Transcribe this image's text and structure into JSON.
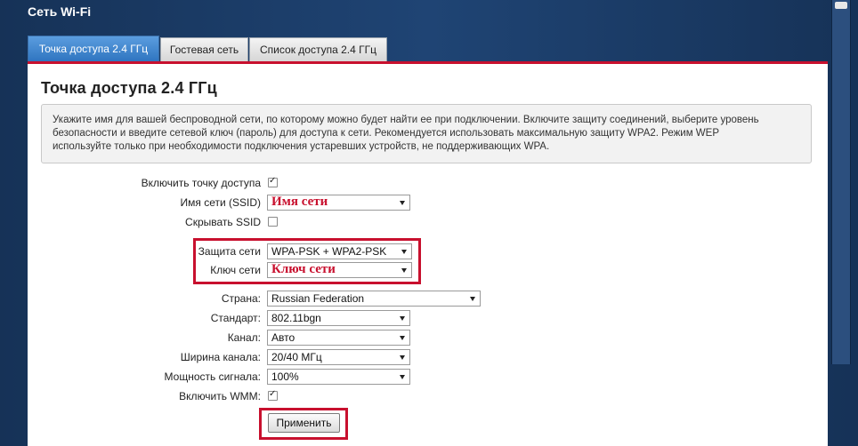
{
  "app": {
    "title": "Сеть Wi-Fi"
  },
  "tabs": [
    {
      "label": "Точка доступа 2.4 ГГц",
      "active": true
    },
    {
      "label": "Гостевая сеть",
      "active": false
    },
    {
      "label": "Список доступа 2.4 ГГц",
      "active": false
    }
  ],
  "page": {
    "title": "Точка доступа 2.4 ГГц",
    "info_line1": "Укажите имя для вашей беспроводной сети, по которому можно будет найти ее при подключении. Включите защиту соединений, выберите уровень",
    "info_line2": "безопасности и введите сетевой ключ (пароль) для доступа к сети. Рекомендуется использовать максимальную защиту WPA2. Режим WEP",
    "info_line3": "используйте только при необходимости подключения устаревших устройств, не поддерживающих WPA."
  },
  "form": {
    "enable_ap": {
      "label": "Включить точку доступа",
      "checked": true
    },
    "ssid": {
      "label": "Имя сети (SSID)",
      "value": "Имя сети"
    },
    "hide_ssid": {
      "label": "Скрывать SSID",
      "checked": false
    },
    "security": {
      "label": "Защита сети",
      "value": "WPA-PSK + WPA2-PSK"
    },
    "key": {
      "label": "Ключ сети",
      "value": "Ключ сети"
    },
    "country": {
      "label": "Страна:",
      "value": "Russian Federation"
    },
    "standard": {
      "label": "Стандарт:",
      "value": "802.11bgn"
    },
    "channel": {
      "label": "Канал:",
      "value": "Авто"
    },
    "bandwidth": {
      "label": "Ширина канала:",
      "value": "20/40 МГц"
    },
    "power": {
      "label": "Мощность сигнала:",
      "value": "100%"
    },
    "wmm": {
      "label": "Включить WMM:",
      "checked": true
    },
    "apply_label": "Применить"
  },
  "colors": {
    "accent_red": "#c8102e",
    "tab_active_blue": "#2f75c0",
    "frame_blue": "#1f4474"
  }
}
